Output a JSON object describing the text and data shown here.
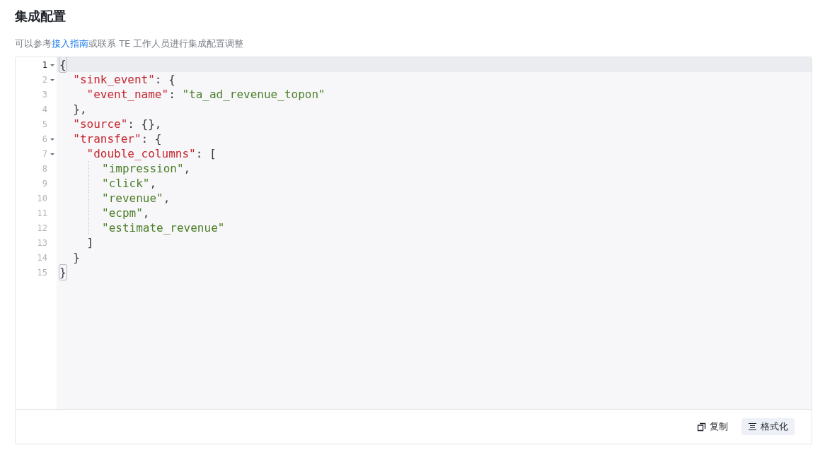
{
  "title": "集成配置",
  "description": {
    "before": "可以参考",
    "link": "接入指南",
    "after": "或联系 TE 工作人员进行集成配置调整"
  },
  "editor": {
    "lines": [
      {
        "number": "1",
        "foldable": true,
        "active": true,
        "guide": false,
        "tokens": [
          {
            "kind": "punct",
            "text": "{",
            "matched": true
          }
        ]
      },
      {
        "number": "2",
        "foldable": true,
        "active": false,
        "guide": false,
        "tokens": [
          {
            "kind": "key",
            "text": "  \"sink_event\"",
            "matched": false
          },
          {
            "kind": "punct",
            "text": ": {",
            "matched": false
          }
        ]
      },
      {
        "number": "3",
        "foldable": false,
        "active": false,
        "guide": false,
        "tokens": [
          {
            "kind": "key",
            "text": "    \"event_name\"",
            "matched": false
          },
          {
            "kind": "punct",
            "text": ": ",
            "matched": false
          },
          {
            "kind": "string",
            "text": "\"ta_ad_revenue_topon\"",
            "matched": false
          }
        ]
      },
      {
        "number": "4",
        "foldable": false,
        "active": false,
        "guide": false,
        "tokens": [
          {
            "kind": "punct",
            "text": "  },",
            "matched": false
          }
        ]
      },
      {
        "number": "5",
        "foldable": false,
        "active": false,
        "guide": false,
        "tokens": [
          {
            "kind": "key",
            "text": "  \"source\"",
            "matched": false
          },
          {
            "kind": "punct",
            "text": ": {},",
            "matched": false
          }
        ]
      },
      {
        "number": "6",
        "foldable": true,
        "active": false,
        "guide": false,
        "tokens": [
          {
            "kind": "key",
            "text": "  \"transfer\"",
            "matched": false
          },
          {
            "kind": "punct",
            "text": ": {",
            "matched": false
          }
        ]
      },
      {
        "number": "7",
        "foldable": true,
        "active": false,
        "guide": false,
        "tokens": [
          {
            "kind": "key",
            "text": "    \"double_columns\"",
            "matched": false
          },
          {
            "kind": "punct",
            "text": ": [",
            "matched": false
          }
        ]
      },
      {
        "number": "8",
        "foldable": false,
        "active": false,
        "guide": true,
        "tokens": [
          {
            "kind": "string",
            "text": "\"impression\"",
            "matched": false
          },
          {
            "kind": "punct",
            "text": ",",
            "matched": false
          }
        ]
      },
      {
        "number": "9",
        "foldable": false,
        "active": false,
        "guide": true,
        "tokens": [
          {
            "kind": "string",
            "text": "\"click\"",
            "matched": false
          },
          {
            "kind": "punct",
            "text": ",",
            "matched": false
          }
        ]
      },
      {
        "number": "10",
        "foldable": false,
        "active": false,
        "guide": true,
        "tokens": [
          {
            "kind": "string",
            "text": "\"revenue\"",
            "matched": false
          },
          {
            "kind": "punct",
            "text": ",",
            "matched": false
          }
        ]
      },
      {
        "number": "11",
        "foldable": false,
        "active": false,
        "guide": true,
        "tokens": [
          {
            "kind": "string",
            "text": "\"ecpm\"",
            "matched": false
          },
          {
            "kind": "punct",
            "text": ",",
            "matched": false
          }
        ]
      },
      {
        "number": "12",
        "foldable": false,
        "active": false,
        "guide": true,
        "tokens": [
          {
            "kind": "string",
            "text": "\"estimate_revenue\"",
            "matched": false
          }
        ]
      },
      {
        "number": "13",
        "foldable": false,
        "active": false,
        "guide": false,
        "tokens": [
          {
            "kind": "punct",
            "text": "    ]",
            "matched": false
          }
        ]
      },
      {
        "number": "14",
        "foldable": false,
        "active": false,
        "guide": false,
        "tokens": [
          {
            "kind": "punct",
            "text": "  }",
            "matched": false
          }
        ]
      },
      {
        "number": "15",
        "foldable": false,
        "active": false,
        "guide": false,
        "tokens": [
          {
            "kind": "punct",
            "text": "}",
            "matched": true
          }
        ]
      }
    ]
  },
  "actions": [
    {
      "kind": "copy",
      "label": "复制",
      "selected": false
    },
    {
      "kind": "format",
      "label": "格式化",
      "selected": true
    }
  ]
}
